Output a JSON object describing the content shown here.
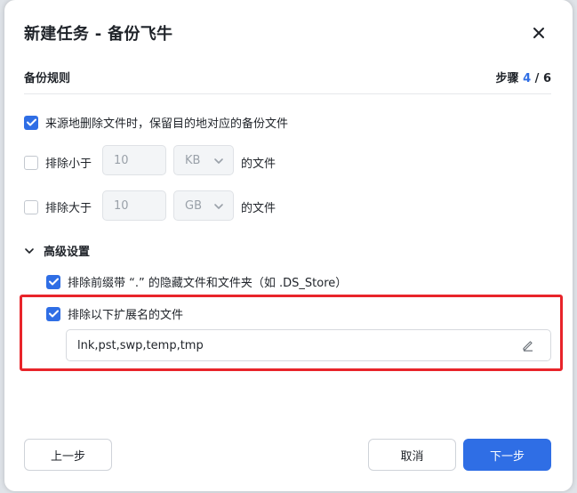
{
  "dialog": {
    "title": "新建任务 - 备份飞牛",
    "close_icon": "close-icon"
  },
  "section": {
    "title": "备份规则",
    "step_label": "步骤",
    "step_current": "4",
    "step_separator": "/",
    "step_total": "6"
  },
  "rules": {
    "keep_deleted": {
      "label": "来源地删除文件时，保留目的地对应的备份文件",
      "checked": true
    },
    "exclude_smaller": {
      "label": "排除小于",
      "checked": false,
      "value": "10",
      "unit": "KB",
      "suffix": "的文件"
    },
    "exclude_larger": {
      "label": "排除大于",
      "checked": false,
      "value": "10",
      "unit": "GB",
      "suffix": "的文件"
    }
  },
  "advanced": {
    "title": "高级设置",
    "expanded": true,
    "exclude_hidden": {
      "label": "排除前缀带 “.” 的隐藏文件和文件夹（如 .DS_Store）",
      "checked": true
    },
    "exclude_ext": {
      "label": "排除以下扩展名的文件",
      "checked": true,
      "value": "lnk,pst,swp,temp,tmp"
    }
  },
  "footer": {
    "prev_label": "上一步",
    "cancel_label": "取消",
    "next_label": "下一步"
  },
  "colors": {
    "accent": "#2f6ee5",
    "highlight": "#e8242a"
  }
}
